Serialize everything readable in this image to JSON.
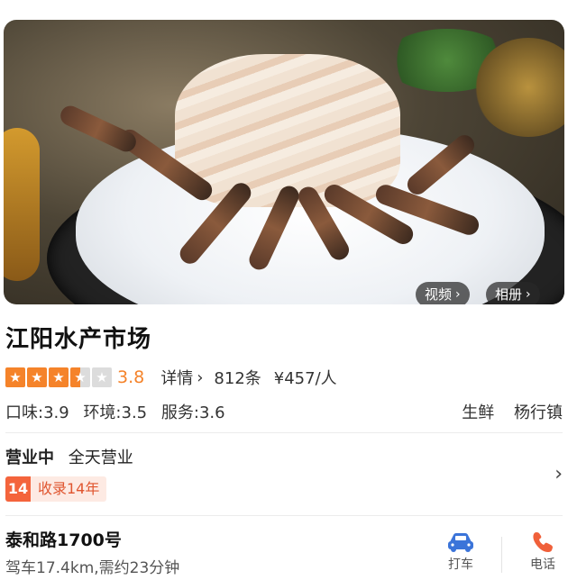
{
  "hero": {
    "video_label": "视频",
    "album_label": "相册"
  },
  "shop": {
    "name": "江阳水产市场",
    "rating": 3.8,
    "score_text": "3.8",
    "stars_filled": 3.5,
    "stars_total": 5,
    "detail_label": "详情",
    "review_count": "812条",
    "avg_price": "¥457/人",
    "taste": "口味:3.9",
    "environment": "环境:3.5",
    "service": "服务:3.6",
    "category": "生鲜",
    "area": "杨行镇"
  },
  "hours": {
    "status": "营业中",
    "schedule": "全天营业",
    "badge_number": "14",
    "badge_text": "收录14年"
  },
  "location": {
    "address": "泰和路1700号",
    "distance": "驾车17.4km,需约23分钟",
    "taxi_label": "打车",
    "phone_label": "电话"
  },
  "colors": {
    "accent": "#f5832a",
    "badge": "#f4643c",
    "taxi_icon": "#3b74d9",
    "phone_icon": "#f0603a"
  }
}
